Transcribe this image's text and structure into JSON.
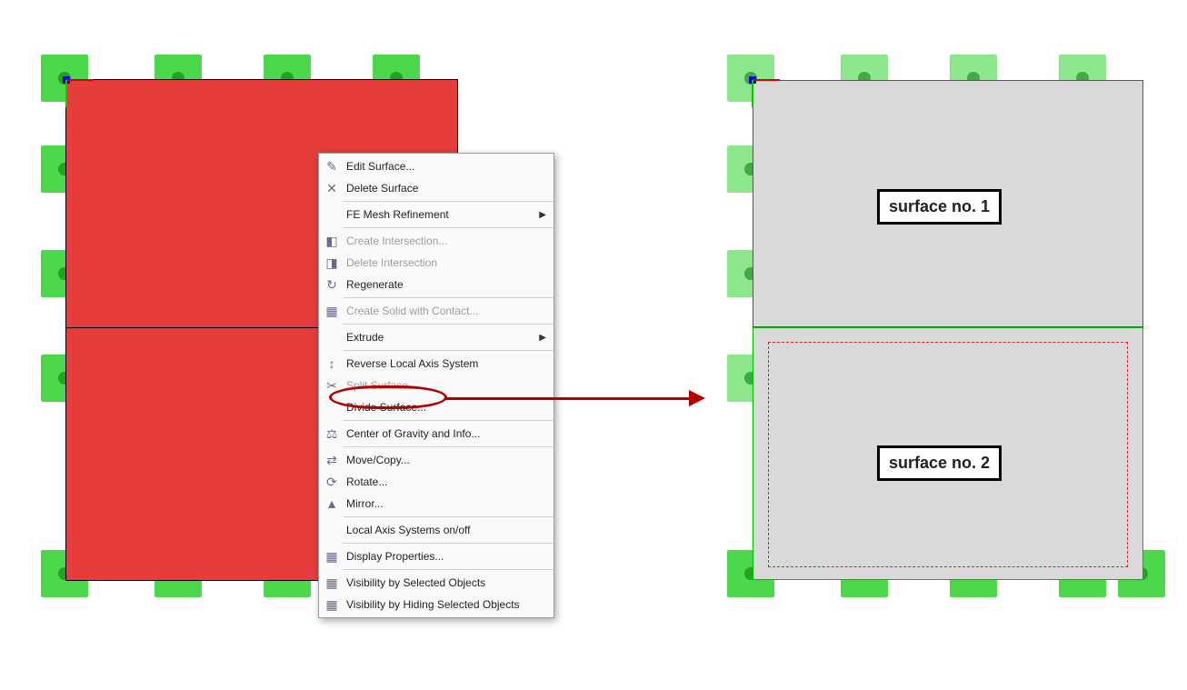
{
  "labels": {
    "surface1": "surface no. 1",
    "surface2": "surface no. 2"
  },
  "context_menu": {
    "items": [
      {
        "label": "Edit Surface...",
        "disabled": false,
        "submenu": false,
        "icon": "✎"
      },
      {
        "label": "Delete Surface",
        "disabled": false,
        "submenu": false,
        "icon": "✕"
      },
      {
        "sep": true
      },
      {
        "label": "FE Mesh Refinement",
        "disabled": false,
        "submenu": true,
        "icon": ""
      },
      {
        "sep": true
      },
      {
        "label": "Create Intersection...",
        "disabled": true,
        "submenu": false,
        "icon": "◧"
      },
      {
        "label": "Delete Intersection",
        "disabled": true,
        "submenu": false,
        "icon": "◨"
      },
      {
        "label": "Regenerate",
        "disabled": false,
        "submenu": false,
        "icon": "↻"
      },
      {
        "sep": true
      },
      {
        "label": "Create Solid with Contact...",
        "disabled": true,
        "submenu": false,
        "icon": "▦"
      },
      {
        "sep": true
      },
      {
        "label": "Extrude",
        "disabled": false,
        "submenu": true,
        "icon": ""
      },
      {
        "sep": true
      },
      {
        "label": "Reverse Local Axis System",
        "disabled": false,
        "submenu": false,
        "icon": "↕"
      },
      {
        "label": "Split Surface...",
        "disabled": true,
        "submenu": false,
        "icon": "✂"
      },
      {
        "label": "Divide Surface...",
        "disabled": false,
        "submenu": false,
        "icon": "",
        "highlight": true
      },
      {
        "sep": true
      },
      {
        "label": "Center of Gravity and Info...",
        "disabled": false,
        "submenu": false,
        "icon": "⚖"
      },
      {
        "sep": true
      },
      {
        "label": "Move/Copy...",
        "disabled": false,
        "submenu": false,
        "icon": "⇄"
      },
      {
        "label": "Rotate...",
        "disabled": false,
        "submenu": false,
        "icon": "⟳"
      },
      {
        "label": "Mirror...",
        "disabled": false,
        "submenu": false,
        "icon": "▲"
      },
      {
        "sep": true
      },
      {
        "label": "Local Axis Systems on/off",
        "disabled": false,
        "submenu": false,
        "icon": ""
      },
      {
        "sep": true
      },
      {
        "label": "Display Properties...",
        "disabled": false,
        "submenu": false,
        "icon": "▦"
      },
      {
        "sep": true
      },
      {
        "label": "Visibility by Selected Objects",
        "disabled": false,
        "submenu": false,
        "icon": "▦"
      },
      {
        "label": "Visibility by Hiding Selected Objects",
        "disabled": false,
        "submenu": false,
        "icon": "▦"
      }
    ]
  },
  "left_surface": {
    "selected_color": "#e53d3b"
  },
  "right_surfaces": {
    "fill_color": "#d9d9d9"
  }
}
